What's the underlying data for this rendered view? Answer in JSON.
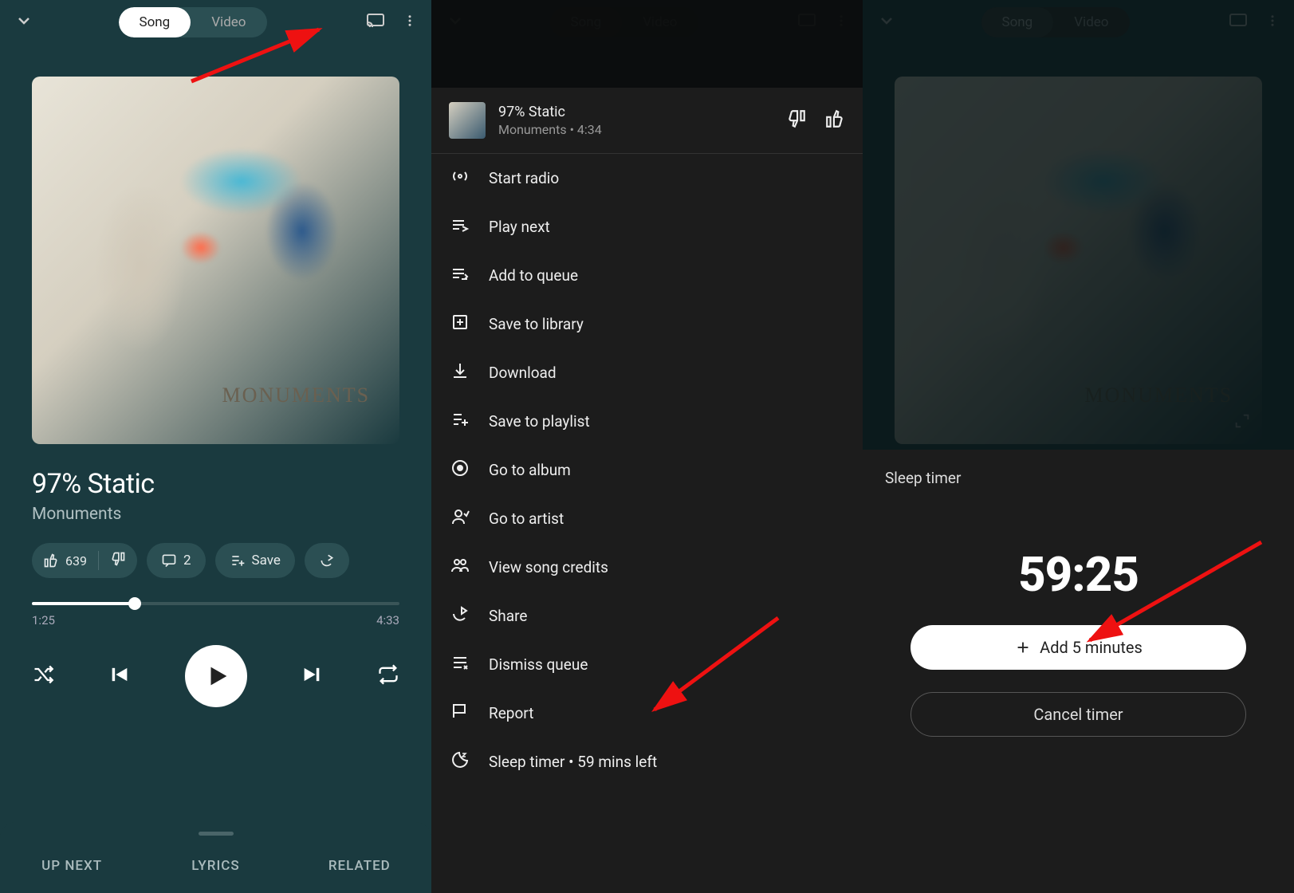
{
  "toggle": {
    "song": "Song",
    "video": "Video"
  },
  "track": {
    "title": "97% Static",
    "artist": "Monuments",
    "duration": "4:34"
  },
  "actions": {
    "likes": "639",
    "comments": "2",
    "save": "Save"
  },
  "progress": {
    "current": "1:25",
    "total": "4:33"
  },
  "tabs": {
    "upnext": "UP NEXT",
    "lyrics": "LYRICS",
    "related": "RELATED"
  },
  "menu": {
    "title": "97% Static",
    "subtitle": "Monuments • 4:34",
    "items": [
      "Start radio",
      "Play next",
      "Add to queue",
      "Save to library",
      "Download",
      "Save to playlist",
      "Go to album",
      "Go to artist",
      "View song credits",
      "Share",
      "Dismiss queue",
      "Report",
      "Sleep timer • 59 mins left"
    ]
  },
  "timer": {
    "title": "Sleep timer",
    "value": "59:25",
    "add": "Add 5 minutes",
    "cancel": "Cancel timer"
  },
  "art": {
    "label": "MONUMENTS"
  }
}
